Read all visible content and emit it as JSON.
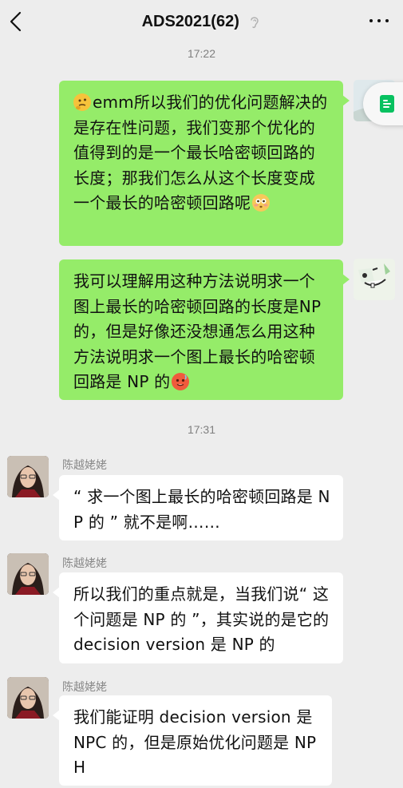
{
  "header": {
    "title": "ADS2021(62)",
    "back_icon": "chevron-left-icon",
    "mute_icon": "ear-icon",
    "more_icon": "more-dots-icon"
  },
  "timestamps": [
    "17:22",
    "17:31"
  ],
  "messages": [
    {
      "sender": "me",
      "text": "emm所以我们的优化问题解决的是存在性问题，我们变那个优化的值得到的是一个最长哈密顿回路的长度；那我们怎么从这个长度变成一个最长的哈密顿回路呢",
      "lead_emoji": "thinking-face-icon",
      "trail_emoji": "flushed-face-icon"
    },
    {
      "sender": "me",
      "text": "我可以理解用这种方法说明求一个图上最长的哈密顿回路的长度是NP 的，但是好像还没想通怎么用这种方法说明求一个图上最长的哈密顿回路是 NP 的",
      "trail_emoji": "hot-face-icon"
    },
    {
      "sender": "陈越姥姥",
      "text": "“ 求一个图上最长的哈密顿回路是 NP 的 ” 就不是啊……"
    },
    {
      "sender": "陈越姥姥",
      "text": "所以我们的重点就是，当我们说“ 这个问题是 NP 的 ”，其实说的是它的 decision version 是 NP 的"
    },
    {
      "sender": "陈越姥姥",
      "text": "我们能证明 decision version 是 NPC 的，但是原始优化问题是 NPH"
    }
  ],
  "colors": {
    "background": "#ededed",
    "outgoing_bubble": "#95ec69",
    "incoming_bubble": "#ffffff",
    "timestamp": "#7f7f7f",
    "sender_name": "#8a8a8a"
  }
}
